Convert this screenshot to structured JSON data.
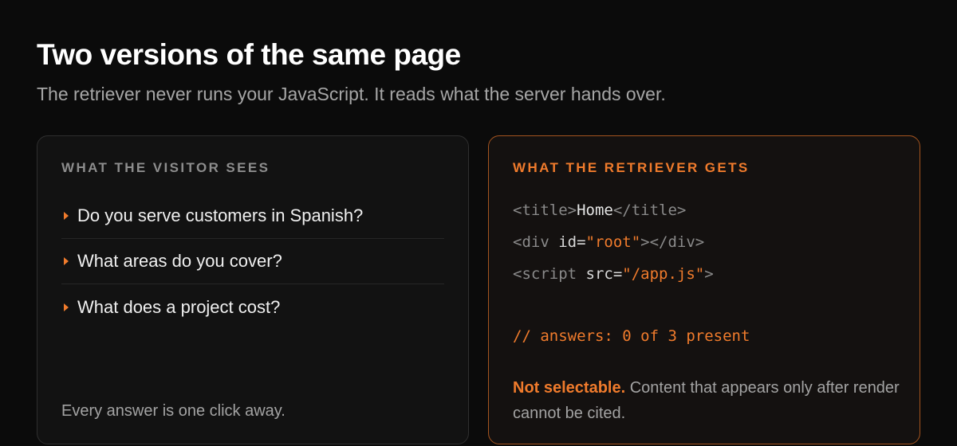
{
  "header": {
    "title": "Two versions of the same page",
    "subtitle": "The retriever never runs your JavaScript. It reads what the server hands over."
  },
  "visitor_card": {
    "label": "WHAT THE VISITOR SEES",
    "items": [
      {
        "icon": "caret-right-icon",
        "text": "Do you serve customers in Spanish?"
      },
      {
        "icon": "caret-right-icon",
        "text": "What areas do you cover?"
      },
      {
        "icon": "caret-right-icon",
        "text": "What does a project cost?"
      }
    ],
    "footer": "Every answer is one click away."
  },
  "retriever_card": {
    "label": "WHAT THE RETRIEVER GETS",
    "code": {
      "title_open": "<title>",
      "title_text": "Home",
      "title_close": "</title>",
      "div_open": "<div ",
      "div_attr": "id=",
      "div_value": "\"root\"",
      "div_close": "></div>",
      "script_open": "<script ",
      "script_attr": "src=",
      "script_value": "\"/app.js\"",
      "script_close": ">"
    },
    "comment": "// answers: 0 of 3 present",
    "note_strong": "Not selectable.",
    "note_text": " Content that appears only after render cannot be cited."
  },
  "colors": {
    "accent": "#f07b2c",
    "background": "#0b0b0b",
    "card_background": "#121212"
  }
}
